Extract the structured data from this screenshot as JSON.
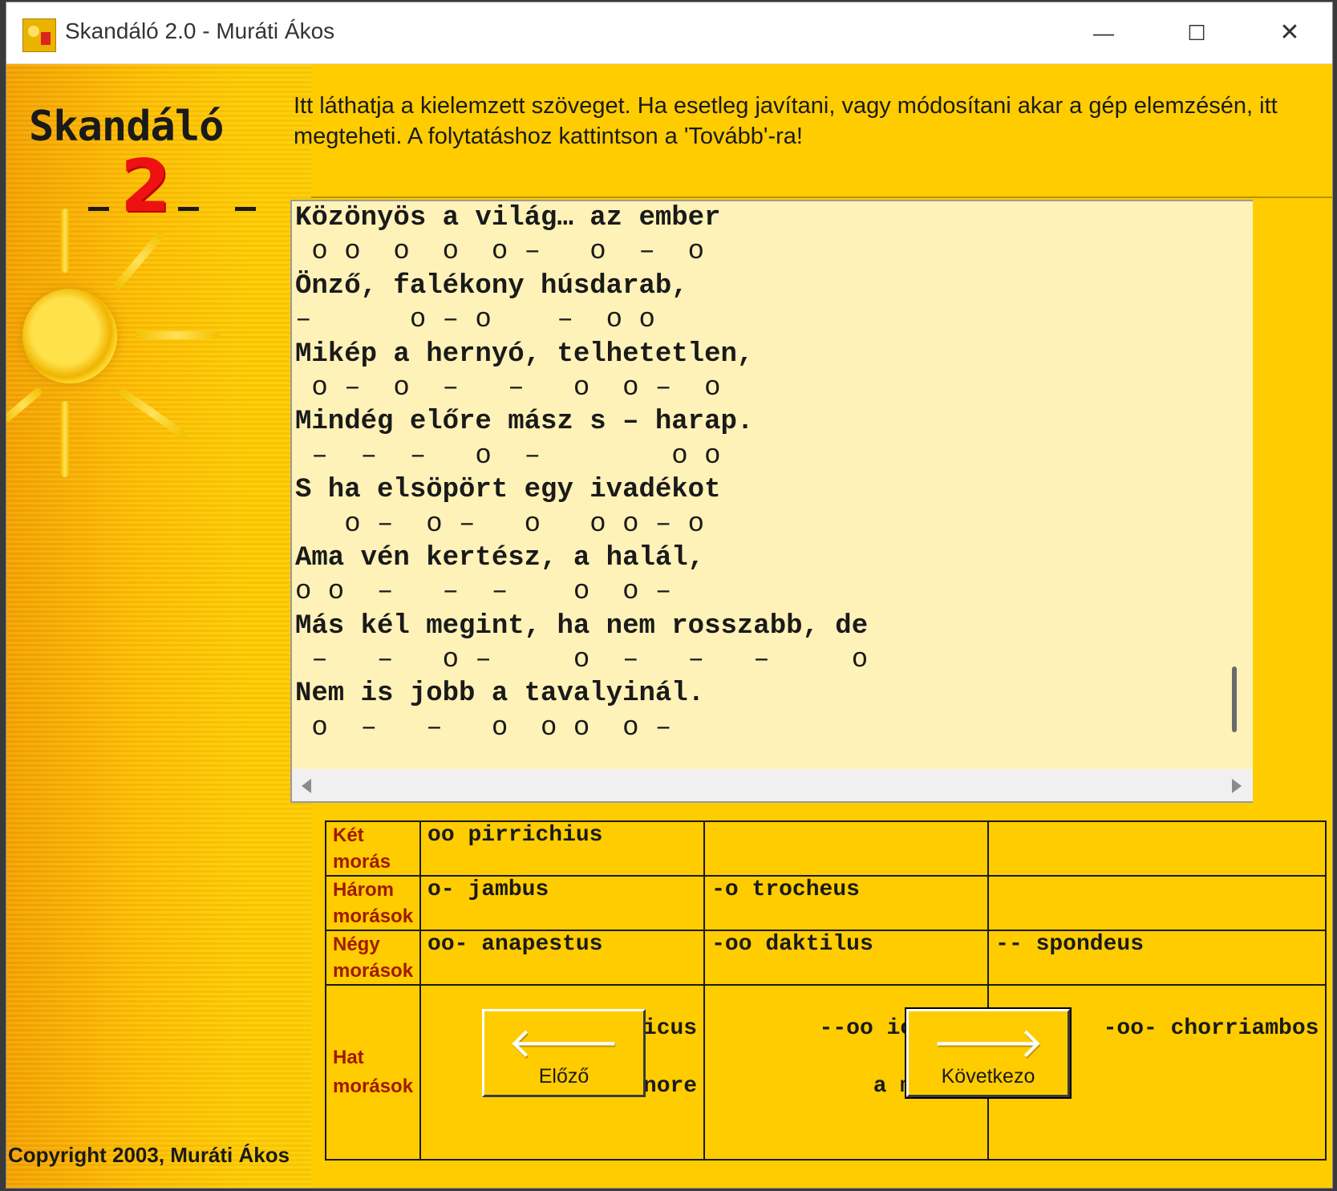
{
  "window": {
    "title": "Skandáló 2.0 - Muráti Ákos",
    "controls": {
      "minimize": "—",
      "maximize": "☐",
      "close": "✕"
    }
  },
  "sidebar": {
    "logo_text": "Skandáló",
    "logo_number": "2",
    "copyright": "Copyright 2003, Muráti Ákos"
  },
  "instructions": "Itt láthatja a kielemzett szöveget. Ha esetleg javítani, vagy módosítani akar a gép elemzésén, itt megteheti. A folytatáshoz kattintson a 'Tovább'-ra!",
  "analysis": {
    "lines": [
      {
        "text": "Közönyös a világ… az ember",
        "meter": " o o  o  o  o –   o  –  o"
      },
      {
        "text": "Önző, falékony húsdarab,",
        "meter": "–      o – o    –  o o"
      },
      {
        "text": "Mikép a hernyó, telhetetlen,",
        "meter": " o –  o  –   –   o  o –  o"
      },
      {
        "text": "Mindég előre mász s – harap.",
        "meter": " –  –  –   o  –        o o"
      },
      {
        "text": "S ha elsöpört egy ivadékot",
        "meter": "   o –  o –   o   o o – o"
      },
      {
        "text": "Ama vén kertész, a halál,",
        "meter": "o o  –   –  –    o  o –"
      },
      {
        "text": "Más kél megint, ha nem rosszabb, de",
        "meter": " –   –   o –     o  –   –   –     o"
      },
      {
        "text": "Nem is jobb a tavalyinál.",
        "meter": " o  –   –   o  o o  o –"
      }
    ]
  },
  "legend": {
    "rows": [
      {
        "category": "Két morás",
        "feet": [
          "oo pirrichius",
          "",
          ""
        ]
      },
      {
        "category": "Három morások",
        "feet": [
          "o- jambus",
          "-o trocheus",
          ""
        ]
      },
      {
        "category": "Négy morások",
        "feet": [
          "oo- anapestus",
          "-oo daktilus",
          "-- spondeus"
        ]
      },
      {
        "category": "Hat morások",
        "feet": [
          {
            "line1": "oo-- ionicus",
            "line2": "a minore"
          },
          {
            "line1": "--oo ionicus",
            "line2": "a maiore"
          },
          {
            "line1": "-oo- chorriambos",
            "line2": ""
          }
        ]
      }
    ]
  },
  "buttons": {
    "prev": {
      "label": "Előző",
      "icon": "arrow-left-icon",
      "glyph": "🡐"
    },
    "next": {
      "label": "Következo",
      "icon": "arrow-right-icon",
      "glyph": "🡒"
    }
  },
  "colors": {
    "background": "#ffcc00",
    "text_area": "#fff2b8",
    "category_text": "#a01a00",
    "logo_number": "#ee1111"
  }
}
